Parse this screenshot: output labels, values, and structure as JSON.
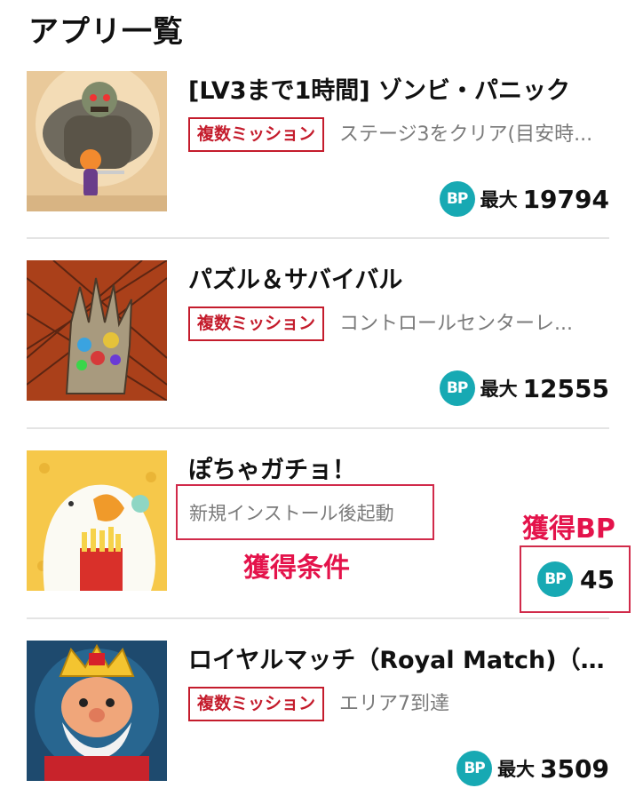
{
  "page": {
    "title": "アプリ一覧"
  },
  "apps": [
    {
      "name": "[LV3まで1時間] ゾンビ・パニック",
      "badge": "複数ミッション",
      "description": "ステージ3をクリア(目安時...",
      "reward_prefix": "最大",
      "reward_value": "19794",
      "thumbnail_icon": "zombie-robot-art"
    },
    {
      "name": "パズル＆サバイバル",
      "badge": "複数ミッション",
      "description": "コントロールセンターレ...",
      "reward_prefix": "最大",
      "reward_value": "12555",
      "thumbnail_icon": "zombie-hand-gems-art"
    },
    {
      "name": "ぽちゃガチョ！",
      "badge": "",
      "description": "新規インストール後起動",
      "reward_prefix": "",
      "reward_value": "45",
      "thumbnail_icon": "goose-fries-art"
    },
    {
      "name": "ロイヤルマッチ（Royal Match)（多...",
      "badge": "複数ミッション",
      "description": "エリア7到達",
      "reward_prefix": "最大",
      "reward_value": "3509",
      "thumbnail_icon": "king-character-art"
    }
  ],
  "bp_icon_label": "BP",
  "annotations": {
    "condition_label": "獲得条件",
    "bp_label": "獲得BP"
  },
  "colors": {
    "accent_red": "#c41c2c",
    "annotation_red": "#e4134b",
    "bp_teal": "#17a9b3"
  }
}
